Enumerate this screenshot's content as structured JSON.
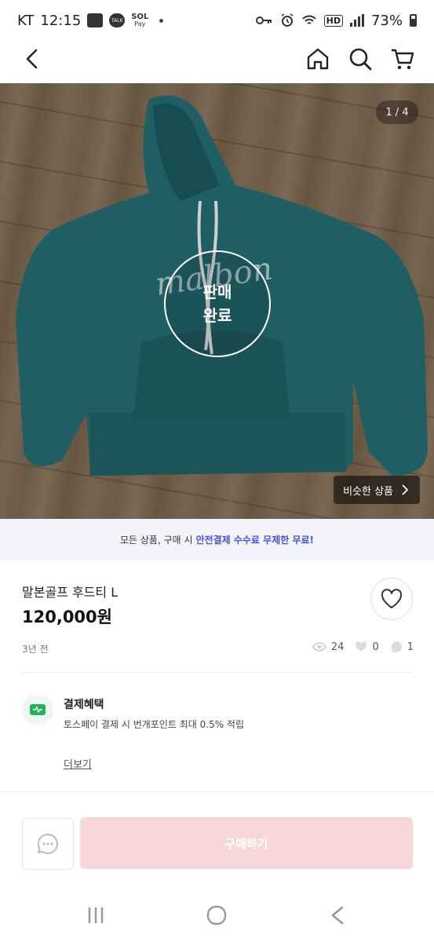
{
  "status_bar": {
    "carrier": "KT",
    "time": "12:15",
    "battery": "73%",
    "left_icons": [
      "gallery-icon",
      "talk-icon",
      "sol-pay-icon",
      "dot-icon"
    ],
    "right_icons": [
      "key-icon",
      "alarm-icon",
      "wifi-icon",
      "hd-icon",
      "signal-icon",
      "battery-icon"
    ],
    "talk_label": "TALK",
    "sol_label": "SOL",
    "pay_label": "Pay",
    "hd_label": "HD"
  },
  "header": {
    "back_icon": "chevron-left-icon",
    "home_icon": "home-icon",
    "search_icon": "search-icon",
    "cart_icon": "cart-icon"
  },
  "gallery": {
    "counter": "1 / 4",
    "sold_line1": "판매",
    "sold_line2": "완료",
    "similar_label": "비슷한 상품",
    "photo_text": "malbon",
    "colors": {
      "garment": "#1f5e63",
      "drawstring": "#cfcfcf"
    }
  },
  "promo": {
    "text": "모든 상품, 구매 시",
    "highlight": "안전결제 수수료 무제한 무료!",
    "accent_color": "#4a52d6"
  },
  "product": {
    "title": "말본골프 후드티 L",
    "price": "120,000원",
    "posted": "3년 전",
    "views": "24",
    "likes": "0",
    "chats": "1"
  },
  "benefit": {
    "title": "결제혜택",
    "description": "토스페이 결제 시 번개포인트 최대 0.5% 적립",
    "more": "더보기",
    "accent_color": "#1fb35b"
  },
  "actions": {
    "buy_label": "구매하기",
    "buy_color": "#f8d7d7"
  }
}
